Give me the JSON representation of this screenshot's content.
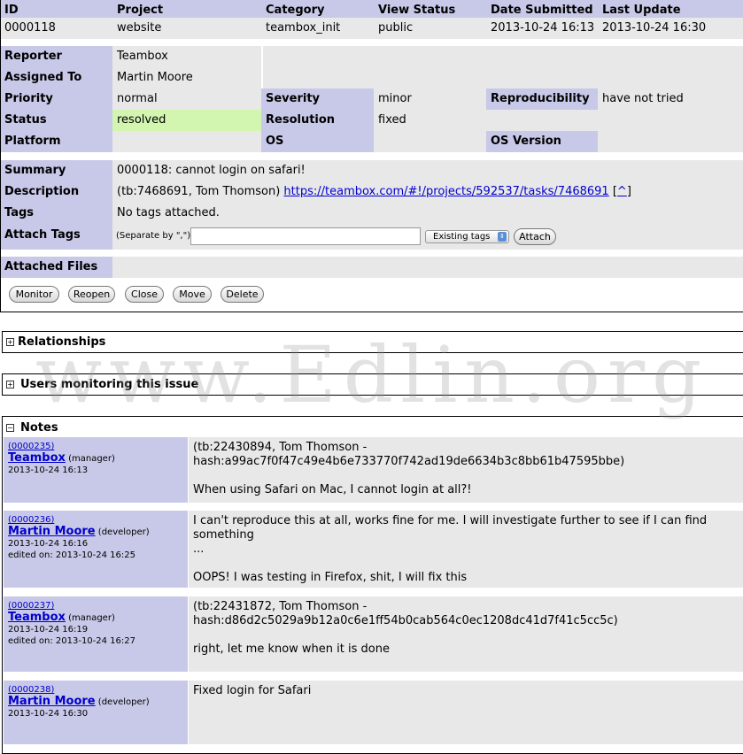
{
  "header": {
    "id_label": "ID",
    "project_label": "Project",
    "category_label": "Category",
    "view_status_label": "View Status",
    "date_submitted_label": "Date Submitted",
    "last_update_label": "Last Update",
    "id": "0000118",
    "project": "website",
    "category": "teambox_init",
    "view_status": "public",
    "date_submitted": "2013-10-24 16:13",
    "last_update": "2013-10-24 16:30"
  },
  "details": {
    "reporter_label": "Reporter",
    "reporter": "Teambox",
    "assigned_label": "Assigned To",
    "assigned": "Martin Moore",
    "priority_label": "Priority",
    "priority": "normal",
    "severity_label": "Severity",
    "severity": "minor",
    "reproducibility_label": "Reproducibility",
    "reproducibility": "have not tried",
    "status_label": "Status",
    "status": "resolved",
    "resolution_label": "Resolution",
    "resolution": "fixed",
    "platform_label": "Platform",
    "platform": "",
    "os_label": "OS",
    "os": "",
    "os_version_label": "OS Version",
    "os_version": ""
  },
  "summary": {
    "summary_label": "Summary",
    "summary": "0000118: cannot login on safari!",
    "description_label": "Description",
    "description_prefix": "(tb:7468691, Tom Thomson)",
    "description_link": "https://teambox.com/#!/projects/592537/tasks/7468691",
    "description_caret": "^",
    "tags_label": "Tags",
    "tags": "No tags attached.",
    "attach_tags_label": "Attach Tags",
    "attach_hint": "(Separate by \",\")",
    "tag_input_value": "",
    "existing_tags": "Existing tags",
    "attach_button": "Attach",
    "attached_files_label": "Attached Files"
  },
  "actions": {
    "monitor": "Monitor",
    "reopen": "Reopen",
    "close": "Close",
    "move": "Move",
    "delete": "Delete"
  },
  "sections": {
    "relationships": "Relationships",
    "monitoring": "Users monitoring this issue",
    "notes": "Notes",
    "toggle_glyph": "⊟"
  },
  "notes": [
    {
      "id": "(0000235)",
      "author": "Teambox",
      "role": "(manager)",
      "date": "2013-10-24 16:13",
      "edited": "",
      "line1": "(tb:22430894, Tom Thomson -",
      "line2": "hash:a99ac7f0f47c49e4b6e733770f742ad19de6634b3c8bb61b47595bbe)",
      "line3": "When using Safari on Mac, I cannot login at all?!"
    },
    {
      "id": "(0000236)",
      "author": "Martin Moore",
      "role": "(developer)",
      "date": "2013-10-24 16:16",
      "edited": "edited on: 2013-10-24 16:25",
      "line1": "I can't reproduce this at all, works fine for me. I will investigate further to see if I can find something",
      "line2": "...",
      "line3": "OOPS! I was testing in Firefox, shit, I will fix this"
    },
    {
      "id": "(0000237)",
      "author": "Teambox",
      "role": "(manager)",
      "date": "2013-10-24 16:19",
      "edited": "edited on: 2013-10-24 16:27",
      "line1": "(tb:22431872, Tom Thomson -",
      "line2": "hash:d86d2c5029a9b12a0c6e1ff54b0cab564c0ec1208dc41d7f41c5cc5c)",
      "line3": "right, let me know when it is done"
    },
    {
      "id": "(0000238)",
      "author": "Martin Moore",
      "role": "(developer)",
      "date": "2013-10-24 16:30",
      "edited": "",
      "line1": "Fixed login for Safari",
      "line2": "",
      "line3": ""
    }
  ],
  "watermark": "www.Edlin.org",
  "colors": {
    "header_bg": "#c8c8e8",
    "value_bg": "#e8e8e8",
    "resolved_bg": "#d2f5b0",
    "link": "#0000cc"
  }
}
